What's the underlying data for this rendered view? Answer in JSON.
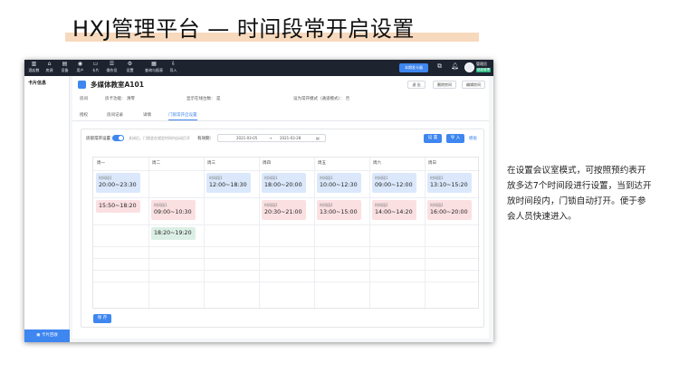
{
  "slide": {
    "title": "HXJ管理平台 — 时间段常开启设置",
    "description": "在设置会议室模式，可按照预约表开放多达7个时间段进行设置，当到达开放时间段内，门锁自动打开。便于参会人员快速进入。"
  },
  "topbar": {
    "nav": [
      {
        "label": "酒店数",
        "icon": "chart-icon"
      },
      {
        "label": "房源",
        "icon": "home-icon"
      },
      {
        "label": "设备",
        "icon": "device-icon"
      },
      {
        "label": "用户",
        "icon": "user-icon"
      },
      {
        "label": "卡片",
        "icon": "card-icon"
      },
      {
        "label": "操作员",
        "icon": "operator-icon"
      },
      {
        "label": "设置",
        "icon": "gear-icon"
      },
      {
        "label": "查询与报表",
        "icon": "report-icon"
      },
      {
        "label": "导入",
        "icon": "import-icon"
      }
    ],
    "main_button": "本期发卡器",
    "user_name": "管理员",
    "user_badge": "超级管理"
  },
  "sidebar": {
    "title": "卡片信息",
    "bottom_button": "卡片回收"
  },
  "room": {
    "title": "多媒体教室A101",
    "buttons": [
      "退 出",
      "删除房间",
      "编辑房间"
    ],
    "info": [
      {
        "label": "房间",
        "value": ""
      },
      {
        "label": "房卡功能：",
        "value": "清零"
      },
      {
        "label": "显示在线台数：",
        "value": "是"
      },
      {
        "label": "设为常开模式（通道模式）：",
        "value": "否"
      }
    ]
  },
  "tabs": [
    "授权",
    "房间记录",
    "详情",
    "门锁常开启设置"
  ],
  "panel": {
    "toggle_label": "房锁常开设置：",
    "hint": "关闭后，门锁会在规定时间内自动打开",
    "date_label": "有效期：",
    "date_from": "2021-03-05",
    "date_arrow": "→",
    "date_to": "2021-03-28",
    "btn_settings": "设 置",
    "btn_import": "导 入",
    "link_template": "模板",
    "save_button": "保 存"
  },
  "schedule": {
    "days": [
      "周一",
      "周二",
      "周三",
      "周四",
      "周五",
      "周六",
      "周日"
    ],
    "slots": [
      {
        "day": 0,
        "row": 0,
        "label": "时间段1",
        "time": "20:00~23:30",
        "color": "blue"
      },
      {
        "day": 2,
        "row": 0,
        "label": "时间段1",
        "time": "12:00~18:30",
        "color": "blue"
      },
      {
        "day": 3,
        "row": 0,
        "label": "时间段1",
        "time": "18:00~20:00",
        "color": "blue"
      },
      {
        "day": 4,
        "row": 0,
        "label": "时间段1",
        "time": "10:00~12:30",
        "color": "blue"
      },
      {
        "day": 5,
        "row": 0,
        "label": "时间段1",
        "time": "09:00~12:00",
        "color": "blue"
      },
      {
        "day": 6,
        "row": 0,
        "label": "时间段1",
        "time": "13:10~15:20",
        "color": "blue"
      },
      {
        "day": 0,
        "row": 1,
        "label": "",
        "time": "15:50~18:20",
        "color": "pink"
      },
      {
        "day": 1,
        "row": 1,
        "label": "时间段1",
        "time": "09:00~10:30",
        "color": "pink"
      },
      {
        "day": 3,
        "row": 1,
        "label": "时间段2",
        "time": "20:30~21:00",
        "color": "pink"
      },
      {
        "day": 4,
        "row": 1,
        "label": "时间段2",
        "time": "13:00~15:00",
        "color": "pink"
      },
      {
        "day": 5,
        "row": 1,
        "label": "时间段2",
        "time": "14:00~14:20",
        "color": "pink"
      },
      {
        "day": 6,
        "row": 1,
        "label": "时间段2",
        "time": "16:00~20:00",
        "color": "pink"
      },
      {
        "day": 1,
        "row": 2,
        "label": "",
        "time": "18:20~19:20",
        "color": "green"
      }
    ]
  }
}
